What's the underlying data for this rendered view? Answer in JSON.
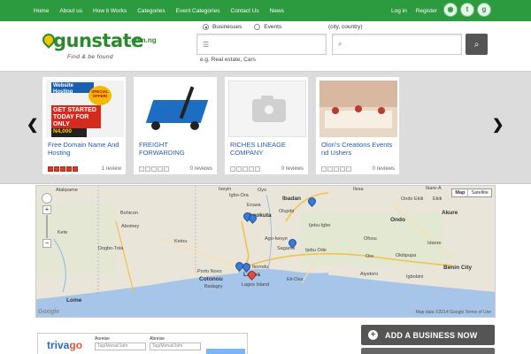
{
  "topnav": {
    "links": [
      "Home",
      "About us",
      "How it Works",
      "Categories",
      "Event Categories",
      "Contact Us",
      "News"
    ],
    "login": "Log in",
    "register": "Register",
    "social": [
      {
        "icon": "rss-icon",
        "glyph": "◉"
      },
      {
        "icon": "twitter-icon",
        "glyph": "t"
      },
      {
        "icon": "google-icon",
        "glyph": "g"
      }
    ]
  },
  "logo": {
    "word": "gunstate",
    "tld": ".com.ng",
    "tagline": "Find & be found"
  },
  "search": {
    "type_options": [
      "Businesses",
      "Events"
    ],
    "selected": "Businesses",
    "location_label": "(city, country)",
    "keyword_value": "",
    "location_value": "",
    "example": "e.g. Real estate, Cars",
    "button_icon": "search-icon"
  },
  "carousel": {
    "prev": "❮",
    "next": "❯",
    "cards": [
      {
        "title": "Free Domain Name And Hosting",
        "rating": 5,
        "reviews": "1 review",
        "thumb": {
          "banner": "Website Hosting",
          "badge": "SPECIAL OFFER!",
          "today": "GET STARTED TODAY FOR ONLY",
          "price": "N4,000"
        }
      },
      {
        "title": "FREIGHT FORWARDING",
        "rating": 0,
        "reviews": "0 reviews"
      },
      {
        "title": "RICHES LINEAGE COMPANY",
        "rating": 0,
        "reviews": "0 reviews"
      },
      {
        "title": "Olori's Creations Events nd Ushers",
        "rating": 0,
        "reviews": "0 reviews"
      }
    ]
  },
  "map": {
    "toggle": [
      "Map",
      "Satellite"
    ],
    "labels": [
      {
        "text": "Atakpame"
      },
      {
        "text": "Bohicon"
      },
      {
        "text": "Abomey"
      },
      {
        "text": "Dogbo-Tota"
      },
      {
        "text": "Lome"
      },
      {
        "text": "Cotonou"
      },
      {
        "text": "Porto Novo"
      },
      {
        "text": "Badagry"
      },
      {
        "text": "Abeokuta"
      },
      {
        "text": "Ibadan"
      },
      {
        "text": "Oyo"
      },
      {
        "text": "Ilesa"
      },
      {
        "text": "Ijebu Ode"
      },
      {
        "text": "Ago-Iwoye"
      },
      {
        "text": "Ikorodu"
      },
      {
        "text": "Lagos"
      },
      {
        "text": "Eti-Osa"
      },
      {
        "text": "Lagos Island"
      },
      {
        "text": "Ondo"
      },
      {
        "text": "Akure"
      },
      {
        "text": "Okitipupa"
      },
      {
        "text": "Benin City"
      },
      {
        "text": "Ikare-A"
      },
      {
        "text": "Eruwa"
      },
      {
        "text": "Igbo-Ora"
      },
      {
        "text": "Iseyin"
      },
      {
        "text": "Olujobi"
      },
      {
        "text": "Sagamu"
      },
      {
        "text": "Ekiti"
      },
      {
        "text": "Ketou"
      },
      {
        "text": "Ore"
      },
      {
        "text": "Ondo Ekiti"
      },
      {
        "text": "Ijebu-Igbo"
      },
      {
        "text": "Aiyetoro"
      },
      {
        "text": "Ofosu"
      },
      {
        "text": "Kete"
      },
      {
        "text": "Igbobini"
      },
      {
        "text": "Idanre"
      }
    ],
    "footer": "Map data ©2014 Google   Terms of Use",
    "brand": "Google"
  },
  "ad": {
    "brand_main": "triva",
    "brand_accent": "go",
    "arrive_label": "Anreise",
    "depart_label": "Abreise",
    "date_placeholder": "Tag/Monat/Jahr"
  },
  "actions": {
    "add_business": "ADD A BUSINESS NOW"
  }
}
